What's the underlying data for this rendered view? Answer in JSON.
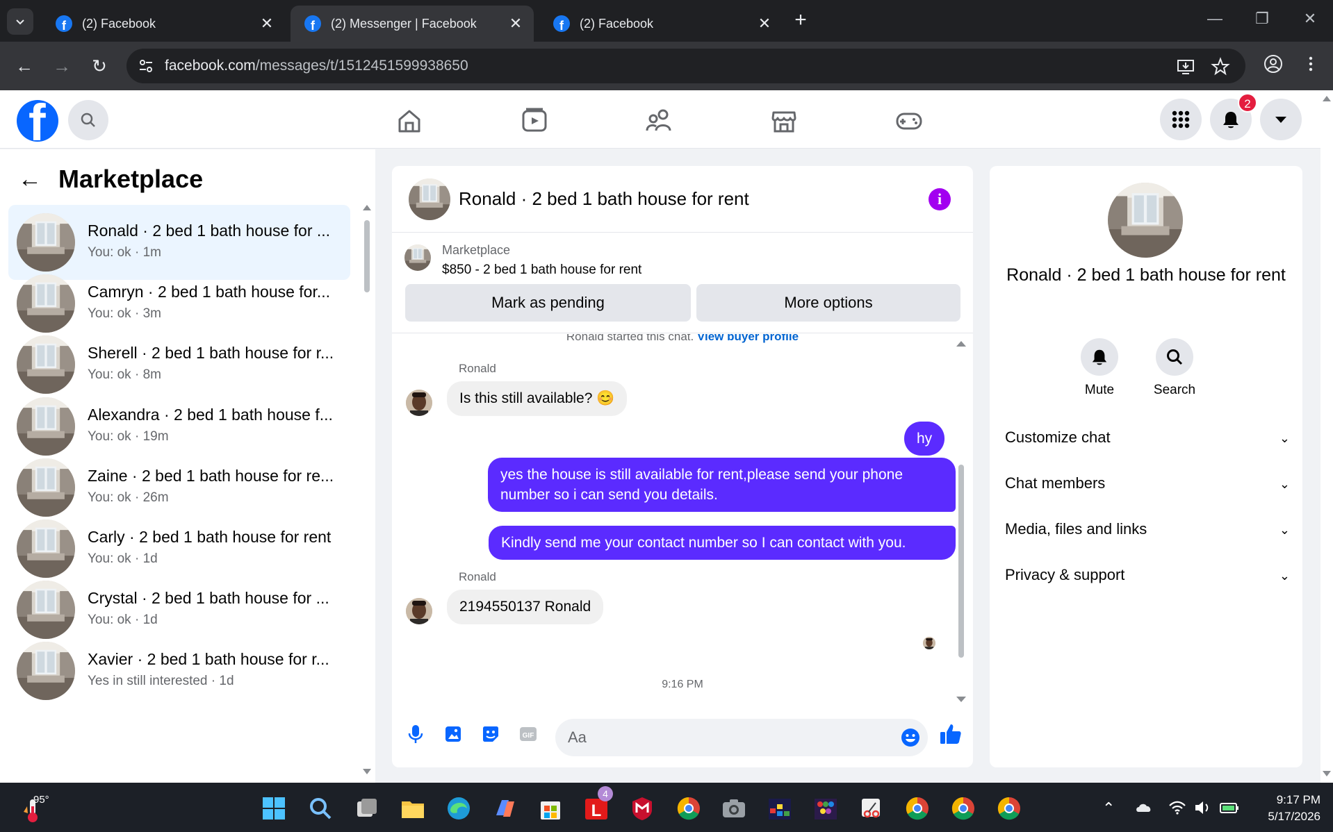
{
  "browser": {
    "tabs": [
      {
        "title": "(2) Facebook",
        "active": false
      },
      {
        "title": "(2) Messenger | Facebook",
        "active": true
      },
      {
        "title": "(2) Facebook",
        "active": false
      }
    ],
    "url_host": "facebook.com",
    "url_path": "/messages/t/1512451599938650"
  },
  "fb": {
    "notification_count": "2"
  },
  "left": {
    "title": "Marketplace",
    "conversations": [
      {
        "name": "Ronald · 2 bed 1 bath house for ...",
        "preview": "You: ok · 1m"
      },
      {
        "name": "Camryn · 2 bed 1 bath house for...",
        "preview": "You: ok · 3m"
      },
      {
        "name": "Sherell · 2 bed 1 bath house for r...",
        "preview": "You: ok · 8m"
      },
      {
        "name": "Alexandra · 2 bed 1 bath house f...",
        "preview": "You: ok · 19m"
      },
      {
        "name": "Zaine · 2 bed 1 bath house for re...",
        "preview": "You: ok · 26m"
      },
      {
        "name": "Carly · 2 bed 1 bath house for rent",
        "preview": "You: ok · 1d"
      },
      {
        "name": "Crystal · 2 bed 1 bath house for ...",
        "preview": "You: ok · 1d"
      },
      {
        "name": "Xavier · 2 bed 1 bath house for r...",
        "preview": "Yes in still interested · 1d"
      }
    ]
  },
  "chat": {
    "title": "Ronald · 2 bed 1 bath house for rent",
    "listing_source": "Marketplace",
    "listing_title": "$850 - 2 bed 1 bath house for rent",
    "mark_pending": "Mark as pending",
    "more_options": "More options",
    "started_text": "Ronald started this chat.",
    "view_profile": "View buyer profile",
    "sender": "Ronald",
    "msg_in_1": "Is this still available? 😊",
    "msg_out_1": "hy",
    "msg_out_2": "yes the house is still available for rent,please send your phone number so i can send you details.",
    "msg_out_3": "Kindly send me your contact number so I can contact with you.",
    "msg_in_2": "2194550137 Ronald",
    "timestamp": "9:16 PM",
    "composer_placeholder": "Aa"
  },
  "info": {
    "name": "Ronald · 2 bed 1 bath house for rent",
    "mute": "Mute",
    "search": "Search",
    "sections": [
      "Customize chat",
      "Chat members",
      "Media, files and links",
      "Privacy & support"
    ]
  },
  "taskbar": {
    "temperature": "95°",
    "time": "9:17 PM",
    "date": "5/17/2026",
    "mail_badge": "4"
  },
  "colors": {
    "fb_blue": "#0866ff",
    "messenger_purple": "#5b2bff",
    "info_purple": "#a200f0",
    "selected_bg": "#ebf5ff"
  }
}
